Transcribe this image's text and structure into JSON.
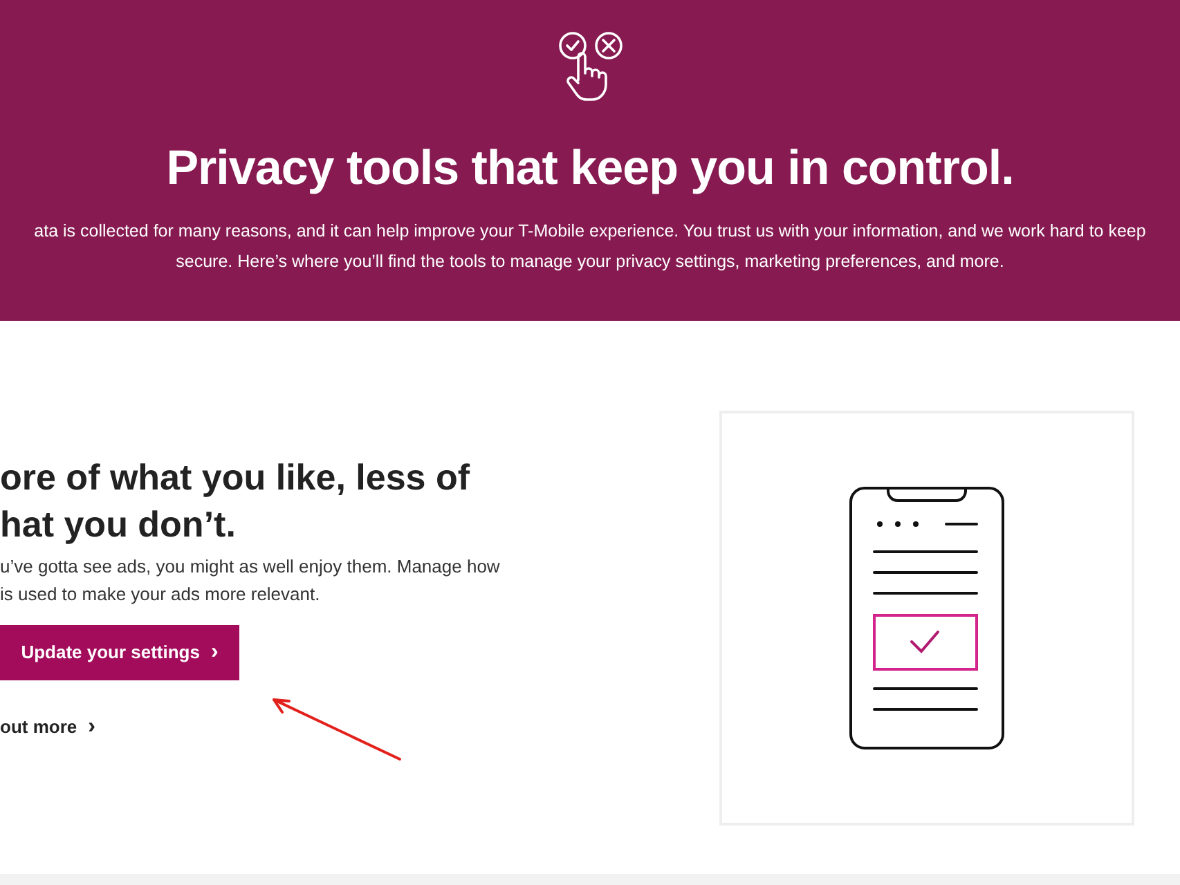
{
  "banner": {
    "title": "Privacy tools that keep you in control.",
    "description_lines": [
      "ata is collected for many reasons, and it can help improve your T-Mobile experience. You trust us with your information, and we work hard to keep",
      "secure. Here’s where you’ll find the tools to manage your privacy settings, marketing preferences, and more."
    ]
  },
  "feature": {
    "heading_lines": [
      "ore of what you like, less of",
      "hat you don’t."
    ],
    "description_lines": [
      "u’ve gotta see ads, you might as well enjoy them. Manage how",
      "is used to make your ads more relevant."
    ],
    "button": {
      "label": "Update your settings",
      "chevron": "›"
    },
    "link": {
      "label": "out more",
      "chevron": "›"
    }
  }
}
